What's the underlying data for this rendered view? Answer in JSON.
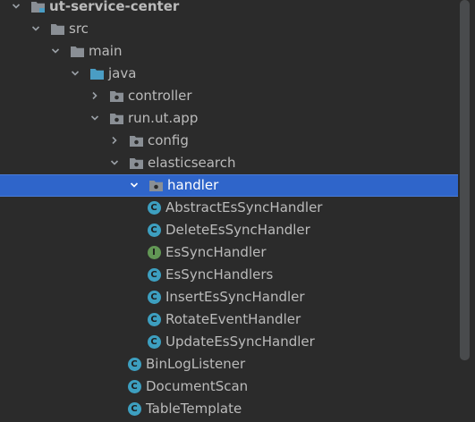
{
  "tree": {
    "nodes": [
      {
        "label": "ut-service-center",
        "depth": 0,
        "expanded": true,
        "icon": "module-folder-icon",
        "bold": true
      },
      {
        "label": "src",
        "depth": 1,
        "expanded": true,
        "icon": "folder-icon"
      },
      {
        "label": "main",
        "depth": 2,
        "expanded": true,
        "icon": "folder-icon"
      },
      {
        "label": "java",
        "depth": 3,
        "expanded": true,
        "icon": "source-root-folder-icon"
      },
      {
        "label": "controller",
        "depth": 4,
        "expanded": false,
        "icon": "package-icon"
      },
      {
        "label": "run.ut.app",
        "depth": 4,
        "expanded": true,
        "icon": "package-icon"
      },
      {
        "label": "config",
        "depth": 5,
        "expanded": false,
        "icon": "package-icon"
      },
      {
        "label": "elasticsearch",
        "depth": 5,
        "expanded": true,
        "icon": "package-icon"
      },
      {
        "label": "handler",
        "depth": 6,
        "expanded": true,
        "icon": "package-icon",
        "selected": true
      },
      {
        "label": "AbstractEsSyncHandler",
        "depth": 7,
        "icon": "class-icon",
        "badge": "C"
      },
      {
        "label": "DeleteEsSyncHandler",
        "depth": 7,
        "icon": "class-icon",
        "badge": "C"
      },
      {
        "label": "EsSyncHandler",
        "depth": 7,
        "icon": "interface-icon",
        "badge": "I"
      },
      {
        "label": "EsSyncHandlers",
        "depth": 7,
        "icon": "class-icon",
        "badge": "C"
      },
      {
        "label": "InsertEsSyncHandler",
        "depth": 7,
        "icon": "class-icon",
        "badge": "C"
      },
      {
        "label": "RotateEventHandler",
        "depth": 7,
        "icon": "class-icon",
        "badge": "C"
      },
      {
        "label": "UpdateEsSyncHandler",
        "depth": 7,
        "icon": "class-icon",
        "badge": "C"
      },
      {
        "label": "BinLogListener",
        "depth": 6,
        "icon": "class-icon",
        "badge": "C"
      },
      {
        "label": "DocumentScan",
        "depth": 6,
        "icon": "class-icon",
        "badge": "C"
      },
      {
        "label": "TableTemplate",
        "depth": 6,
        "icon": "class-icon",
        "badge": "C"
      }
    ]
  },
  "colors": {
    "class_badge": "#3d9fc0",
    "interface_badge": "#629755",
    "folder": "#8a8f95",
    "source_root": "#4a9dc4",
    "selection": "#2f65ca"
  }
}
